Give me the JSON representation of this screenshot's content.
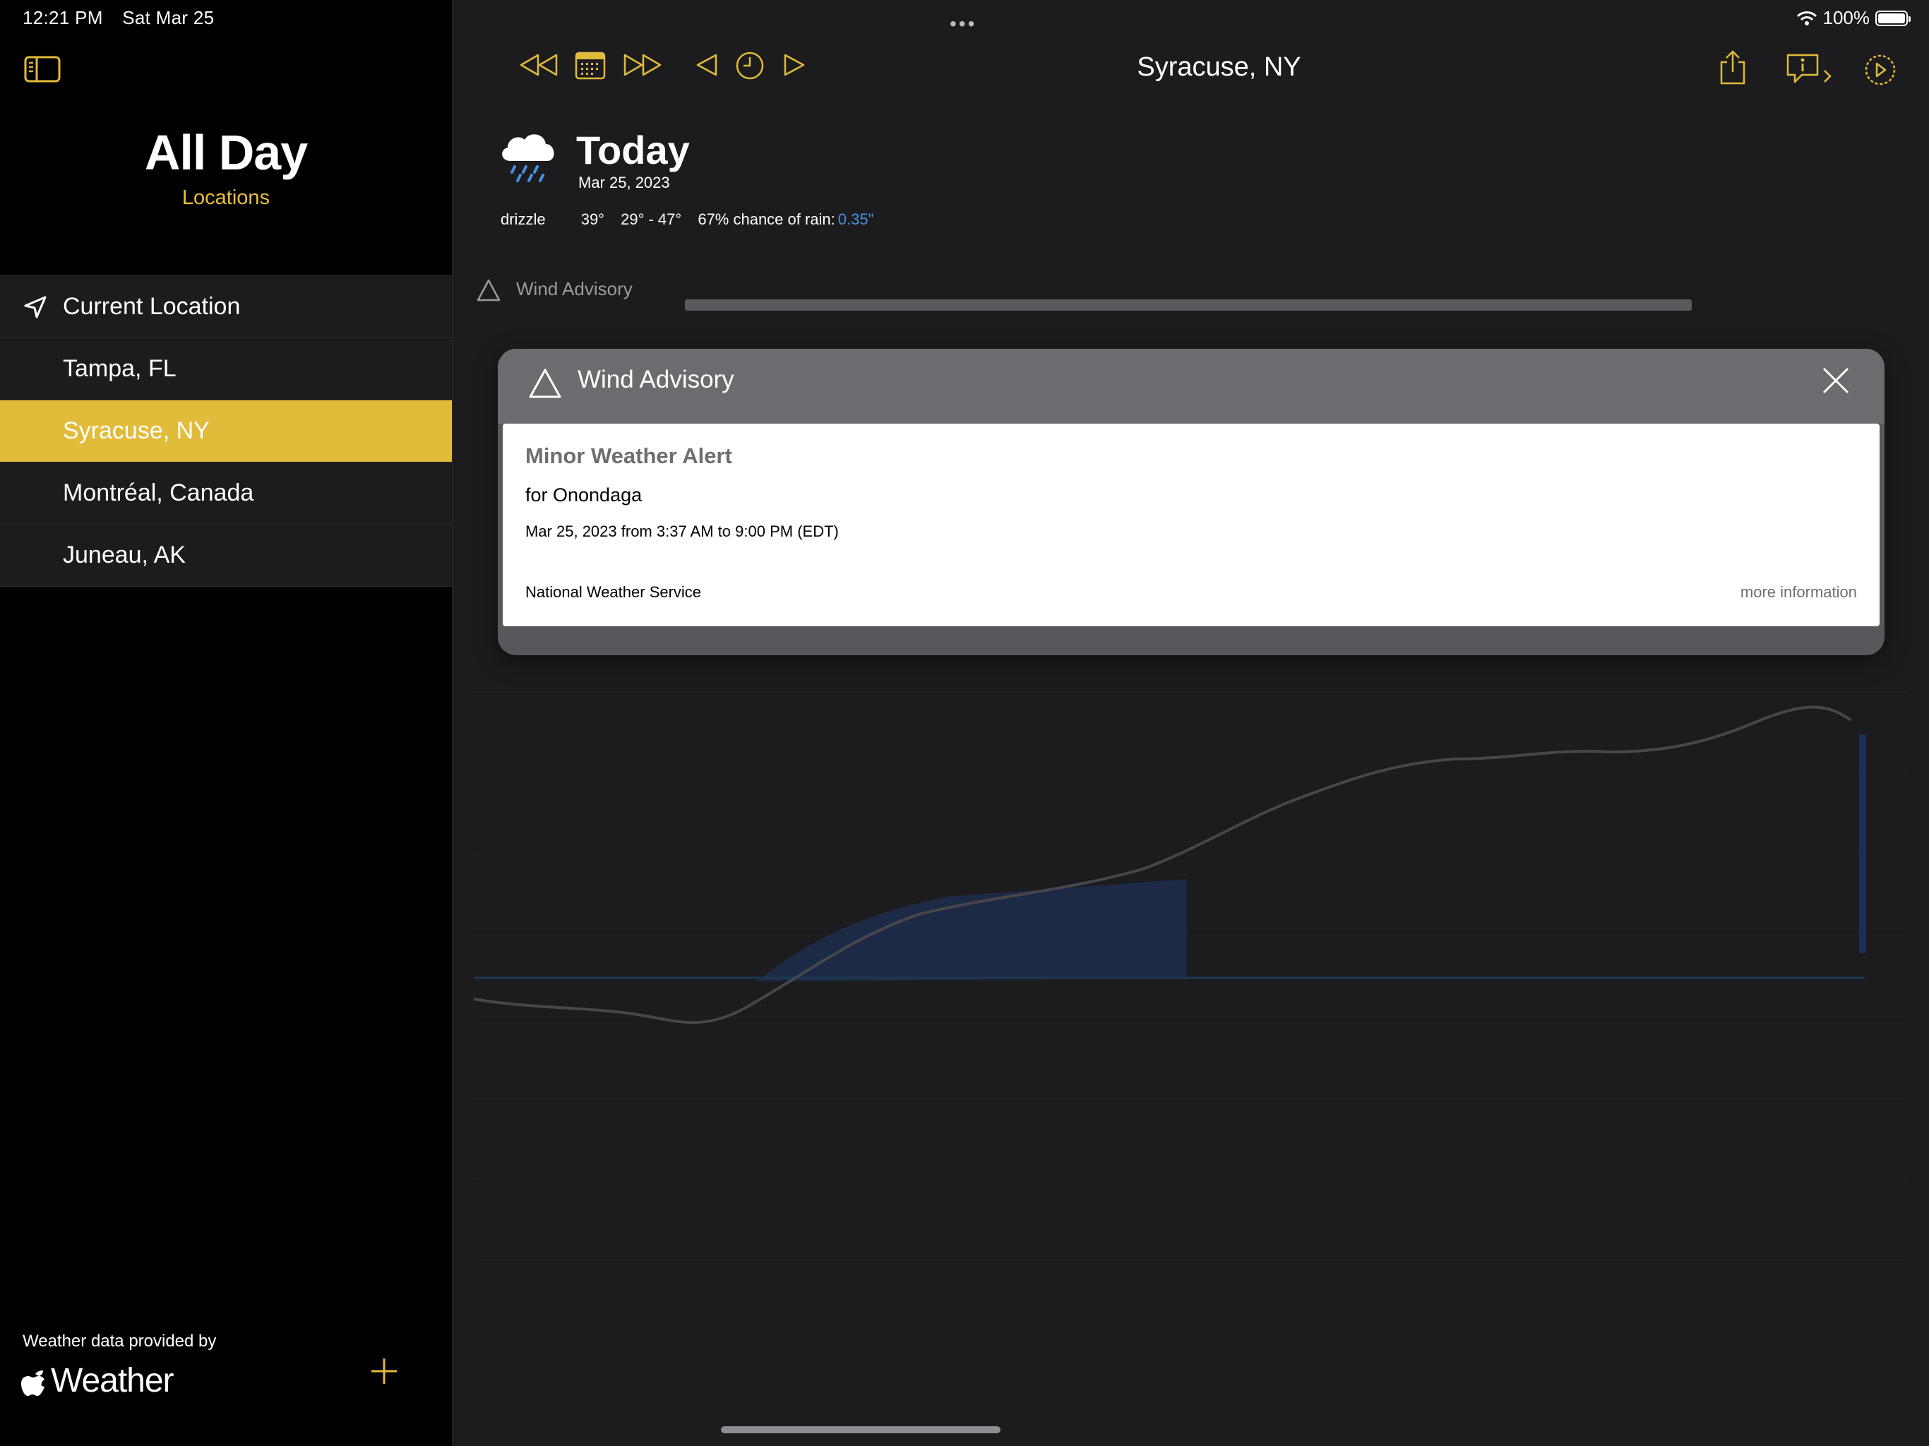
{
  "status_bar": {
    "time": "12:21 PM",
    "date": "Sat Mar 25",
    "battery": "100%"
  },
  "sidebar": {
    "title": "All Day",
    "subtitle": "Locations",
    "items": [
      {
        "label": "Current Location",
        "icon": "location-arrow-icon",
        "selected": false
      },
      {
        "label": "Tampa, FL",
        "selected": false
      },
      {
        "label": "Syracuse, NY",
        "selected": true
      },
      {
        "label": "Montréal, Canada",
        "selected": false
      },
      {
        "label": "Juneau, AK",
        "selected": false
      }
    ],
    "credit": "Weather data provided by",
    "brand": "Weather"
  },
  "toolbar": {
    "title": "Syracuse, NY"
  },
  "forecast": {
    "day": "Today",
    "date": "Mar 25, 2023",
    "condition": "drizzle",
    "current_temp": "39°",
    "range": "29° - 47°",
    "rain_chance": "67% chance of rain:",
    "rain_amount": "0.35\""
  },
  "alert_row": {
    "label": "Wind Advisory"
  },
  "modal": {
    "title": "Wind Advisory",
    "heading": "Minor Weather Alert",
    "area": "for Onondaga",
    "time": "Mar 25, 2023 from 3:37 AM to 9:00 PM (EDT)",
    "source": "National Weather Service",
    "more": "more information"
  },
  "colors": {
    "accent": "#e1bb3a",
    "rain": "#4a90e2",
    "sidebar_bg": "#000000",
    "main_bg": "#1c1c1e"
  }
}
